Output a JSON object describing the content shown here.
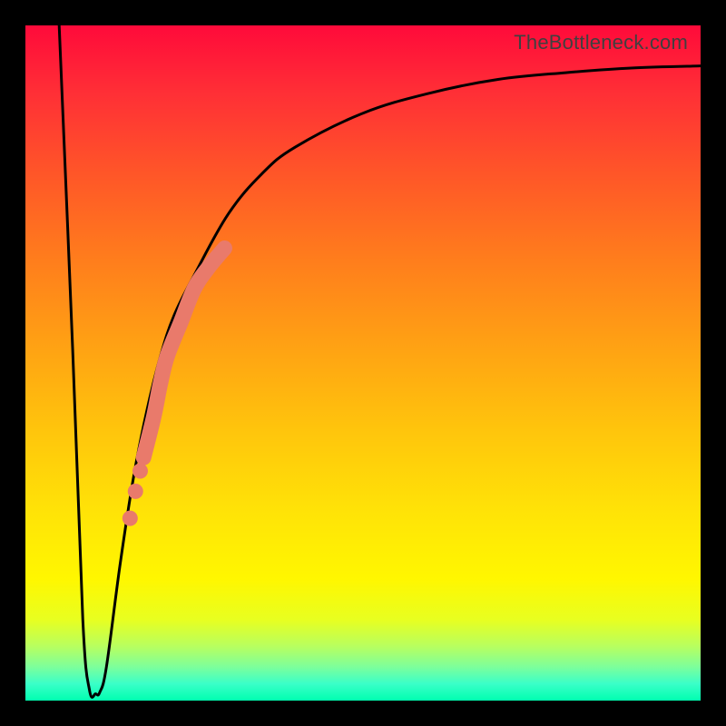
{
  "watermark": "TheBottleneck.com",
  "chart_data": {
    "type": "line",
    "title": "",
    "xlabel": "",
    "ylabel": "",
    "xlim": [
      0,
      100
    ],
    "ylim": [
      0,
      100
    ],
    "series": [
      {
        "name": "bottleneck-curve",
        "x": [
          5,
          7,
          8.5,
          9.5,
          10.4,
          11,
          12,
          14,
          16,
          18,
          20,
          22,
          25,
          30,
          35,
          40,
          50,
          60,
          70,
          80,
          90,
          100
        ],
        "values": [
          100,
          52,
          12,
          1.5,
          1,
          1.2,
          5,
          20,
          33,
          43,
          51,
          57,
          63,
          72,
          78,
          82,
          87,
          90,
          92,
          93,
          93.7,
          94
        ]
      }
    ],
    "highlight_segment": {
      "name": "salmon-band",
      "x": [
        17.5,
        19,
        20,
        21,
        23,
        25,
        27,
        29.5
      ],
      "values": [
        36,
        42,
        47,
        51,
        56,
        61,
        64,
        67
      ]
    },
    "highlight_dots": {
      "name": "salmon-dots",
      "points": [
        {
          "x": 15.5,
          "y": 27
        },
        {
          "x": 16.3,
          "y": 31
        },
        {
          "x": 17.0,
          "y": 34
        }
      ]
    },
    "colors": {
      "curve": "#000000",
      "highlight": "#e97a6b"
    }
  }
}
